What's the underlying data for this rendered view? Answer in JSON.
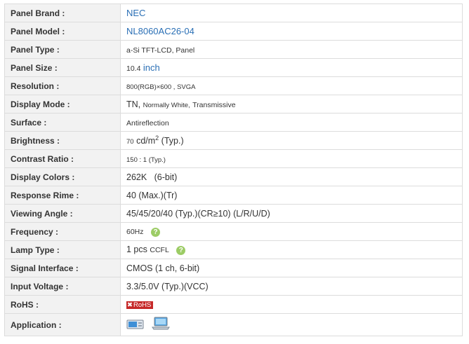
{
  "rows": {
    "brand": {
      "label": "Panel Brand :",
      "value": "NEC"
    },
    "model": {
      "label": "Panel Model :",
      "value": "NL8060AC26-04"
    },
    "type": {
      "label": "Panel Type :",
      "value": "a-Si TFT-LCD, Panel"
    },
    "size": {
      "label": "Panel Size :",
      "value": "10.4",
      "unit": "inch"
    },
    "resolution": {
      "label": "Resolution :",
      "value": "800(RGB)×600 , SVGA"
    },
    "mode": {
      "label": "Display Mode :",
      "prefix": "TN,",
      "middle": "Normally White,",
      "suffix": "Transmissive"
    },
    "surface": {
      "label": "Surface :",
      "value": "Antireflection"
    },
    "brightness": {
      "label": "Brightness :",
      "number": "70",
      "unit": "cd/m",
      "sup": "2",
      "note": "(Typ.)"
    },
    "contrast": {
      "label": "Contrast Ratio :",
      "value": "150 : 1 (Typ.)"
    },
    "colors": {
      "label": "Display Colors :",
      "value": "262K   (6-bit)"
    },
    "response": {
      "label": "Response Rime :",
      "value": "40 (Max.)(Tr)"
    },
    "viewing": {
      "label": "Viewing Angle :",
      "value": "45/45/20/40 (Typ.)(CR≥10) (L/R/U/D)"
    },
    "frequency": {
      "label": "Frequency :",
      "value": "60Hz"
    },
    "lamp": {
      "label": "Lamp Type :",
      "value": "1 pcs",
      "suffix": "CCFL"
    },
    "signal": {
      "label": "Signal Interface :",
      "value": "CMOS (1 ch, 6-bit)"
    },
    "voltage": {
      "label": "Input Voltage :",
      "value": "3.3/5.0V (Typ.)(VCC)"
    },
    "rohs": {
      "label": "RoHS :",
      "badge": "RoHS",
      "mark": "✖"
    },
    "application": {
      "label": "Application :"
    }
  },
  "icons": {
    "help": "question-icon",
    "help_glyph": "?",
    "help_color": "#9ccc65",
    "rohs_color": "#c62828",
    "link_color": "#2a6fb5",
    "app_1": "industrial-device-icon",
    "app_2": "laptop-icon"
  }
}
